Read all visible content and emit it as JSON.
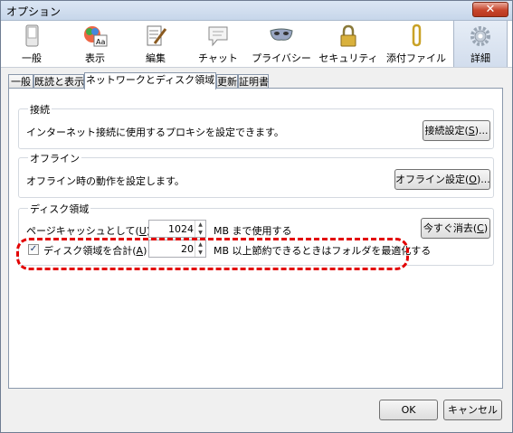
{
  "window": {
    "title": "オプション",
    "close_glyph": "✕"
  },
  "toolbar": {
    "items": [
      {
        "label": "一般",
        "icon": "general-icon"
      },
      {
        "label": "表示",
        "icon": "display-icon"
      },
      {
        "label": "編集",
        "icon": "compose-icon"
      },
      {
        "label": "チャット",
        "icon": "chat-icon"
      },
      {
        "label": "プライバシー",
        "icon": "privacy-mask-icon"
      },
      {
        "label": "セキュリティ",
        "icon": "padlock-icon"
      },
      {
        "label": "添付ファイル",
        "icon": "paperclip-icon"
      },
      {
        "label": "詳細",
        "icon": "gear-icon",
        "selected": true
      }
    ]
  },
  "tabs": [
    "一般",
    "既読と表示",
    "ネットワークとディスク領域",
    "更新",
    "証明書"
  ],
  "active_tab": 2,
  "connection": {
    "title": "接続",
    "desc": "インターネット接続に使用するプロキシを設定できます。",
    "button_pre": "接続設定(",
    "button_key": "S",
    "button_post": ")..."
  },
  "offline": {
    "title": "オフライン",
    "desc": "オフライン時の動作を設定します。",
    "button_pre": "オフライン設定(",
    "button_key": "O",
    "button_post": ")..."
  },
  "disk": {
    "title": "ディスク領域",
    "cache_label_pre": "ページキャッシュとして(",
    "cache_label_key": "U",
    "cache_label_post": ")",
    "cache_value": "1024",
    "cache_unit": "MB まで使用する",
    "clear_pre": "今すぐ消去(",
    "clear_key": "C",
    "clear_post": ")",
    "compact_checked": true,
    "compact_label_pre": "ディスク領域を合計(",
    "compact_label_key": "A",
    "compact_label_post": ")",
    "compact_value": "20",
    "compact_unit": "MB 以上節約できるときはフォルダを最適化する"
  },
  "footer": {
    "ok": "OK",
    "cancel": "キャンセル"
  },
  "colors": {
    "highlight": "#e30000"
  }
}
